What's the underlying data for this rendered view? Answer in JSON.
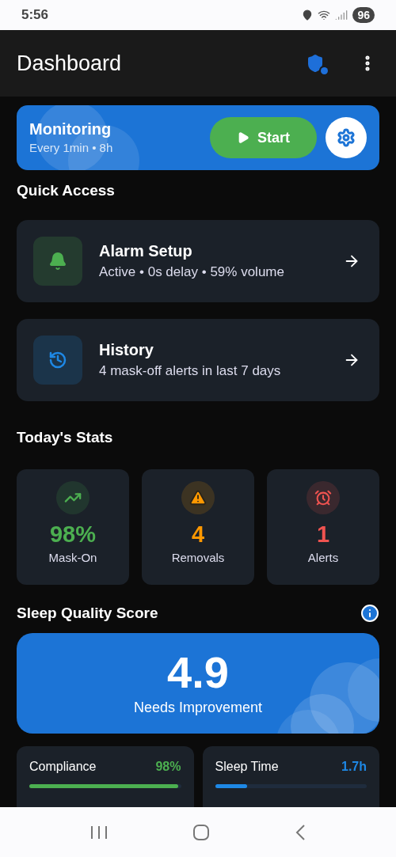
{
  "status_bar": {
    "time": "5:56",
    "battery": "96"
  },
  "app_bar": {
    "title": "Dashboard"
  },
  "monitoring": {
    "title": "Monitoring",
    "subtitle": "Every 1min • 8h",
    "start_label": "Start"
  },
  "quick_access": {
    "title": "Quick Access",
    "items": [
      {
        "kind": "alarm",
        "title": "Alarm Setup",
        "subtitle": "Active • 0s delay • 59% volume",
        "color": "#4caf50"
      },
      {
        "kind": "history",
        "title": "History",
        "subtitle": "4 mask-off alerts in last 7 days",
        "color": "#1e88e5"
      }
    ]
  },
  "todays_stats": {
    "title": "Today's Stats",
    "items": [
      {
        "kind": "trend",
        "value": "98%",
        "label": "Mask-On",
        "color": "#4caf50"
      },
      {
        "kind": "warning",
        "value": "4",
        "label": "Removals",
        "color": "#ff9800"
      },
      {
        "kind": "alarm",
        "value": "1",
        "label": "Alerts",
        "color": "#ef5350"
      }
    ]
  },
  "sleep_quality": {
    "title": "Sleep Quality Score",
    "score": "4.9",
    "rating": "Needs Improvement",
    "metrics": [
      {
        "label": "Compliance",
        "value": "98%",
        "level": 0.98,
        "color": "#4caf50"
      },
      {
        "label": "Sleep Time",
        "value": "1.7h",
        "level": 0.21,
        "color": "#1e88e5"
      }
    ]
  }
}
